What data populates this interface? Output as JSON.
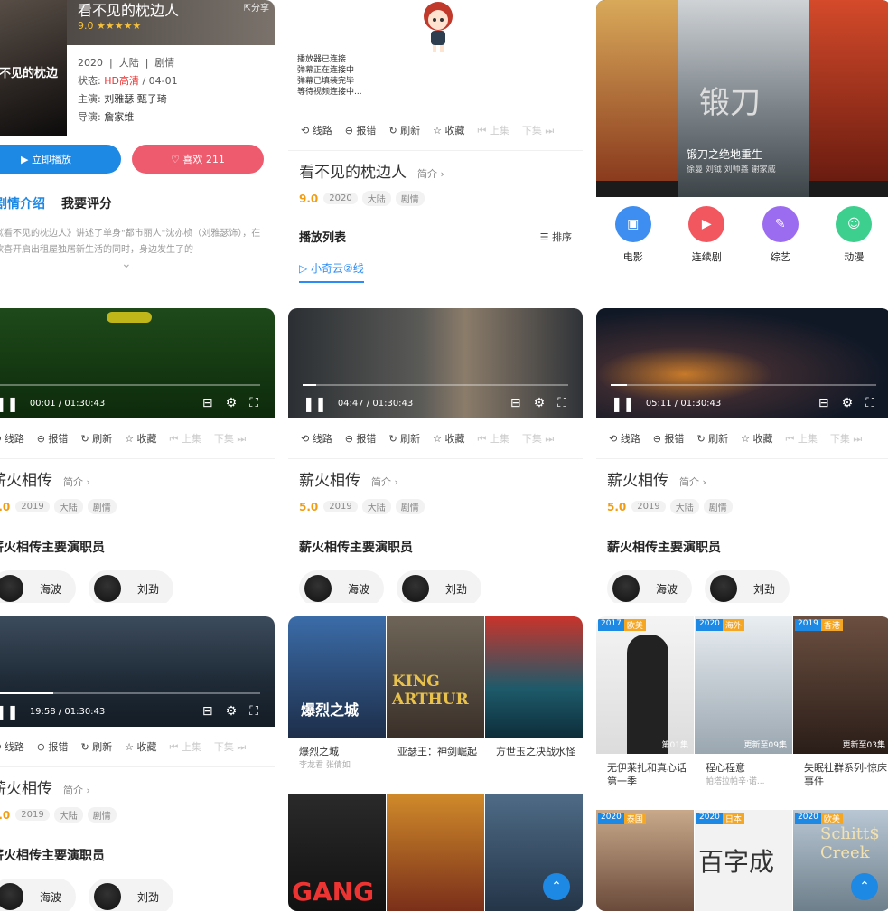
{
  "card1": {
    "title": "看不见的枕边人",
    "share": "分享",
    "rating": "9.0 ★★★★★",
    "year": "2020",
    "region": "大陆",
    "genre": "剧情",
    "status_label": "状态:",
    "status_value": "HD高清",
    "status_date": "/ 04-01",
    "cast_label": "主演:",
    "cast_value": "刘雅瑟 甄子琦",
    "director_label": "导演:",
    "director_value": "詹家维",
    "play_button": "▶ 立即播放",
    "like_button": "♡ 喜欢 211",
    "tab_plot": "剧情介绍",
    "tab_review": "我要评分",
    "description": "《看不见的枕边人》讲述了单身\"都市丽人\"沈亦桢（刘雅瑟饰），在欣喜开启出租屋独居新生活的同时，身边发生了的",
    "expand": "⌄"
  },
  "card2": {
    "log": [
      "播放器已连接",
      "弹幕正在连接中",
      "弹幕已填装完毕",
      "等待视频连接中..."
    ],
    "title": "看不见的枕边人",
    "intro": "简介 ›",
    "score": "9.0",
    "tags": [
      "2020",
      "大陆",
      "剧情"
    ],
    "playlist": "播放列表",
    "sort": "☰ 排序",
    "line": "▷ 小奇云②线"
  },
  "toolbar": {
    "route": "⟲ 线路",
    "report": "⊖ 报错",
    "refresh": "↻ 刷新",
    "favorite": "☆ 收藏",
    "prev": "⏮ 上集",
    "next": "下集 ⏭"
  },
  "card3": {
    "banner_title": "锻刀之绝地重生",
    "banner_cast": "徐曼 刘钺 刘帅鑫 谢家威",
    "poster_text": "锻刀",
    "categories": [
      "电影",
      "连续剧",
      "综艺",
      "动漫"
    ]
  },
  "player": {
    "title": "薪火相传",
    "intro": "简介 ›",
    "score": "5.0",
    "tags": [
      "2019",
      "大陆",
      "剧情"
    ],
    "section": "薪火相传主要演职员",
    "actors": [
      "海波",
      "刘劲"
    ],
    "times": [
      "00:01 / 01:30:43",
      "04:47 / 01:30:43",
      "05:11 / 01:30:43",
      "19:58 / 01:30:43"
    ]
  },
  "grid1": {
    "items": [
      {
        "name": "爆烈之城",
        "sub": "李龙君 张倩如"
      },
      {
        "name": "亚瑟王：神剑崛起",
        "sub": ""
      },
      {
        "name": "方世玉之决战水怪",
        "sub": ""
      }
    ],
    "poster_titles": [
      "爆烈之城",
      "KING ARTHUR",
      "GANG"
    ]
  },
  "grid2": {
    "items": [
      {
        "year": "2017",
        "region": "欧美",
        "name": "无伊莱扎和真心话第一季",
        "sub": "",
        "ep": "第01集"
      },
      {
        "year": "2020",
        "region": "海外",
        "name": "程心程意",
        "sub": "帕塔拉帕辛·诺...",
        "ep": "更新至09集"
      },
      {
        "year": "2019",
        "region": "香港",
        "name": "失眠社群系列-惊床事件",
        "sub": "",
        "ep": "更新至03集"
      }
    ],
    "row2": [
      {
        "year": "2020",
        "region": "泰国"
      },
      {
        "year": "2020",
        "region": "日本",
        "title": "百字成"
      },
      {
        "year": "2020",
        "region": "欧美",
        "title": "Schitt$ Creek"
      }
    ]
  }
}
